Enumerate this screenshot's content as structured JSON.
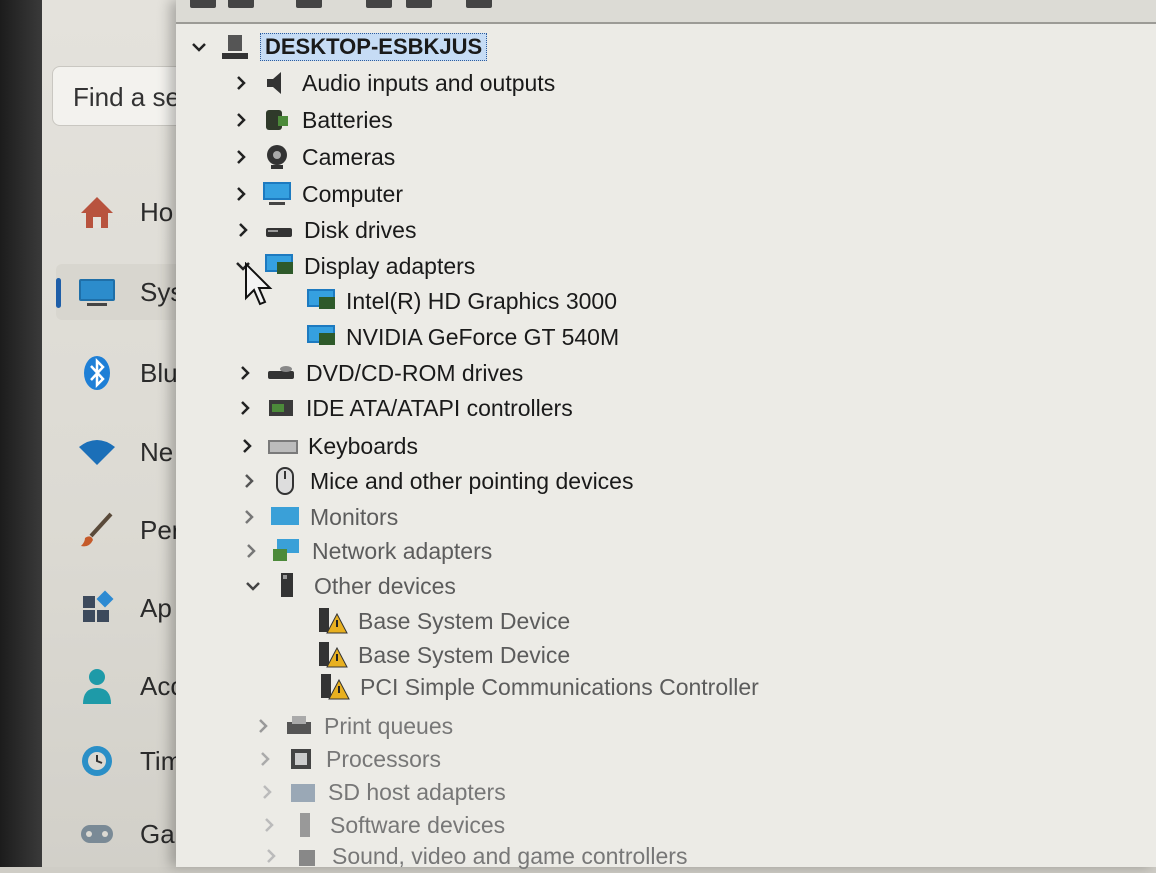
{
  "settings": {
    "search_placeholder": "Find a se",
    "nav": [
      {
        "label": "Ho",
        "icon": "home-icon"
      },
      {
        "label": "Sys",
        "icon": "system-icon",
        "selected": true
      },
      {
        "label": "Blu",
        "icon": "bluetooth-icon"
      },
      {
        "label": "Ne",
        "icon": "network-icon"
      },
      {
        "label": "Per",
        "icon": "personalization-icon"
      },
      {
        "label": "Ap",
        "icon": "apps-icon"
      },
      {
        "label": "Acc",
        "icon": "accounts-icon"
      },
      {
        "label": "Tim",
        "icon": "time-icon"
      },
      {
        "label": "Ga",
        "icon": "gaming-icon"
      }
    ]
  },
  "device_manager": {
    "root": "DESKTOP-ESBKJUS",
    "categories": [
      {
        "label": "Audio inputs and outputs",
        "icon": "speaker-icon",
        "expanded": false
      },
      {
        "label": "Batteries",
        "icon": "battery-icon",
        "expanded": false
      },
      {
        "label": "Cameras",
        "icon": "camera-icon",
        "expanded": false
      },
      {
        "label": "Computer",
        "icon": "computer-icon",
        "expanded": false
      },
      {
        "label": "Disk drives",
        "icon": "disk-drive-icon",
        "expanded": false
      },
      {
        "label": "Display adapters",
        "icon": "display-adapter-icon",
        "expanded": true,
        "children": [
          "Intel(R) HD Graphics 3000",
          "NVIDIA GeForce GT 540M"
        ]
      },
      {
        "label": "DVD/CD-ROM drives",
        "icon": "dvd-drive-icon",
        "expanded": false
      },
      {
        "label": "IDE ATA/ATAPI controllers",
        "icon": "ide-controller-icon",
        "expanded": false
      },
      {
        "label": "Keyboards",
        "icon": "keyboard-icon",
        "expanded": false
      },
      {
        "label": "Mice and other pointing devices",
        "icon": "mouse-icon",
        "expanded": false
      },
      {
        "label": "Monitors",
        "icon": "monitor-icon",
        "expanded": false
      },
      {
        "label": "Network adapters",
        "icon": "network-adapter-icon",
        "expanded": false
      },
      {
        "label": "Other devices",
        "icon": "unknown-device-icon",
        "expanded": true,
        "children": [
          "Base System Device",
          "Base System Device",
          "PCI Simple Communications Controller"
        ]
      },
      {
        "label": "Print queues",
        "icon": "printer-icon",
        "expanded": false
      },
      {
        "label": "Processors",
        "icon": "processor-icon",
        "expanded": false
      },
      {
        "label": "SD host adapters",
        "icon": "sd-adapter-icon",
        "expanded": false
      },
      {
        "label": "Software devices",
        "icon": "software-device-icon",
        "expanded": false
      },
      {
        "label": "Sound, video and game controllers",
        "icon": "sound-controller-icon",
        "expanded": false
      }
    ]
  }
}
